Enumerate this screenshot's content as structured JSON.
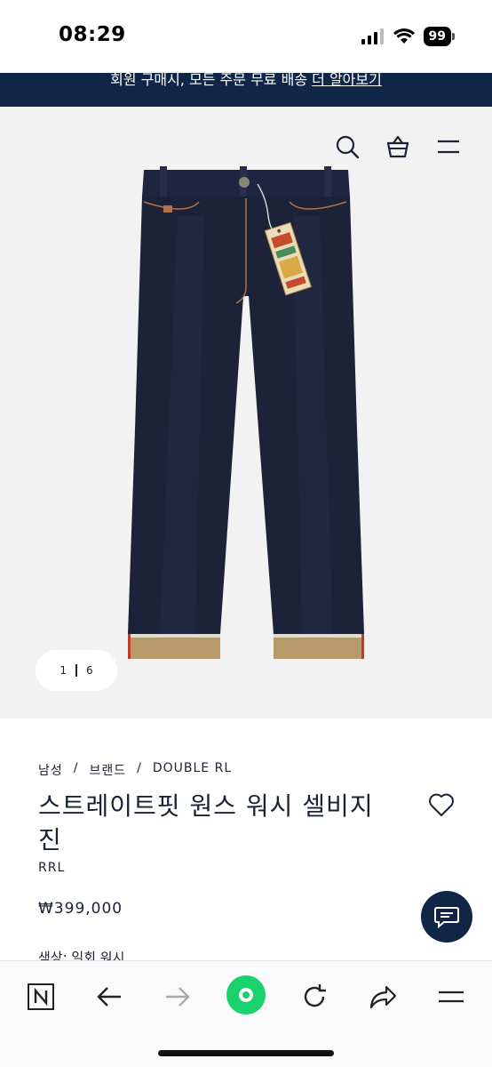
{
  "status_bar": {
    "time": "08:29",
    "battery": "99",
    "icons": [
      "signal-icon",
      "wifi-icon",
      "battery-icon"
    ]
  },
  "promo": {
    "text": "회원 구매시, 모든 주문 무료 배송 ",
    "link": "더 알아보기"
  },
  "header": {
    "icons": [
      "search-icon",
      "shopping-bag-icon",
      "menu-icon"
    ]
  },
  "gallery": {
    "current": "1",
    "total": "6"
  },
  "product": {
    "breadcrumb": [
      "남성",
      "브랜드",
      "DOUBLE RL"
    ],
    "breadcrumb_sep": "/",
    "title": "스트레이트핏 원스 워시 셀비지 진",
    "brand": "RRL",
    "price": "₩399,000",
    "color_label": "색상: 일회 워시"
  },
  "colors": {
    "navy": "#0f2647",
    "hero_bg": "#f2f2f2",
    "denim": "#1c2238",
    "selvedge": "#b79a6a",
    "green_button": "#19d26b"
  },
  "browser_bar": {
    "icons": [
      "naver-n-icon",
      "back-arrow-icon",
      "forward-arrow-icon",
      "home-green-button",
      "reload-icon",
      "share-icon",
      "menu-icon"
    ]
  }
}
